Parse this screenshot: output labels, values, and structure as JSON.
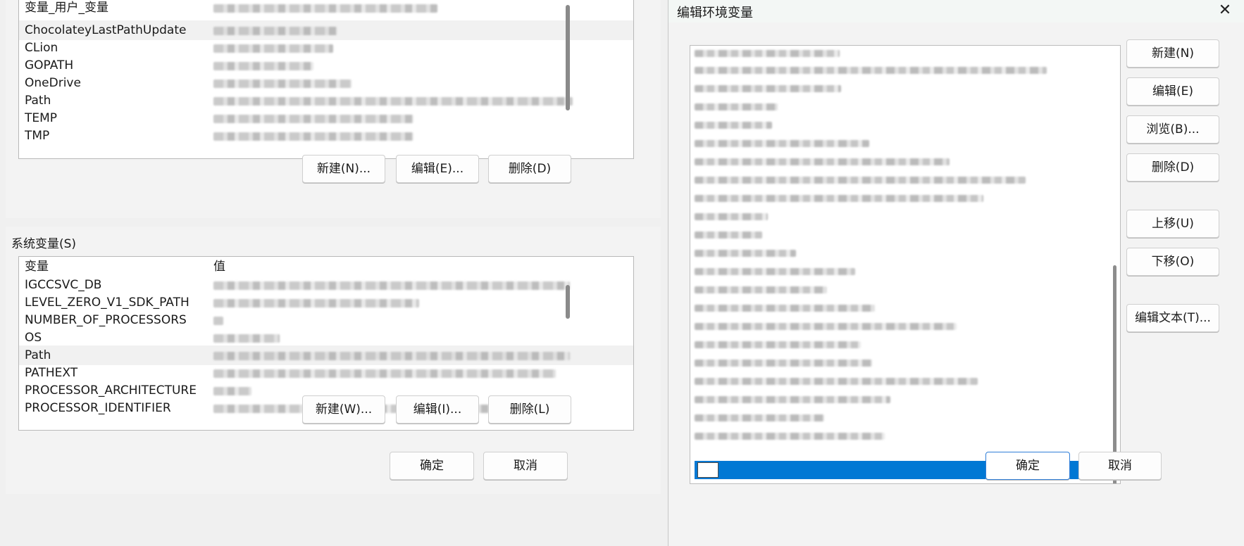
{
  "left_window": {
    "user_section": {
      "list_rows": [
        {
          "name": "变量_用户_变量"
        },
        {
          "name": "ChocolateyLastPathUpdate"
        },
        {
          "name": "CLion"
        },
        {
          "name": "GOPATH"
        },
        {
          "name": "OneDrive"
        },
        {
          "name": "Path"
        },
        {
          "name": "TEMP"
        },
        {
          "name": "TMP"
        }
      ],
      "buttons": {
        "new_label": "新建(N)...",
        "edit_label": "编辑(E)...",
        "delete_label": "删除(D)"
      }
    },
    "system_section": {
      "section_label": "系统变量(S)",
      "header": {
        "name_label": "变量",
        "value_label": "值"
      },
      "list_rows": [
        {
          "name": "IGCCSVC_DB"
        },
        {
          "name": "LEVEL_ZERO_V1_SDK_PATH"
        },
        {
          "name": "NUMBER_OF_PROCESSORS"
        },
        {
          "name": "OS"
        },
        {
          "name": "Path"
        },
        {
          "name": "PATHEXT"
        },
        {
          "name": "PROCESSOR_ARCHITECTURE"
        },
        {
          "name": "PROCESSOR_IDENTIFIER"
        }
      ],
      "buttons": {
        "new_label": "新建(W)...",
        "edit_label": "编辑(I)...",
        "delete_label": "删除(L)"
      }
    },
    "footer_buttons": {
      "ok_label": "确定",
      "cancel_label": "取消"
    }
  },
  "right_window": {
    "title": "编辑环境变量",
    "close_icon": "close-icon",
    "side_buttons": {
      "new_label": "新建(N)",
      "edit_label": "编辑(E)",
      "browse_label": "浏览(B)...",
      "delete_label": "删除(D)",
      "move_up_label": "上移(U)",
      "move_down_label": "下移(O)",
      "edit_text_label": "编辑文本(T)..."
    },
    "footer_buttons": {
      "ok_label": "确定",
      "cancel_label": "取消"
    }
  },
  "colors": {
    "selection_blue": "#0078d4",
    "window_bg": "#f3f3f3",
    "list_bg": "#ffffff"
  }
}
